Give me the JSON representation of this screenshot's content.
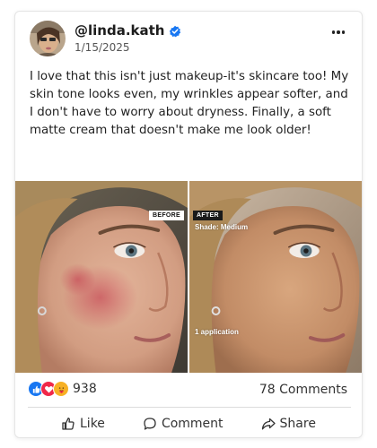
{
  "post": {
    "username": "@linda.kath",
    "date": "1/15/2025",
    "verified_icon": "verified-badge-icon",
    "more_icon": "more-options-icon",
    "text": "I love that this isn't just makeup-it's skincare too! My skin tone looks even, my wrinkles appear softer, and I don't have to worry about dryness. Finally, a soft matte cream that doesn't make me look older!"
  },
  "media": {
    "before_label": "BEFORE",
    "after_label": "AFTER",
    "shade_label": "Shade: Medium",
    "application_label": "1 application"
  },
  "stats": {
    "reaction_icons": [
      "like-reaction-icon",
      "love-reaction-icon",
      "care-reaction-icon"
    ],
    "reaction_count": "938",
    "comments": "78 Comments"
  },
  "actions": {
    "like": "Like",
    "comment": "Comment",
    "share": "Share"
  },
  "colors": {
    "verified": "#1877f2",
    "like": "#1877f2",
    "love": "#f02849",
    "care": "#f7b125"
  }
}
